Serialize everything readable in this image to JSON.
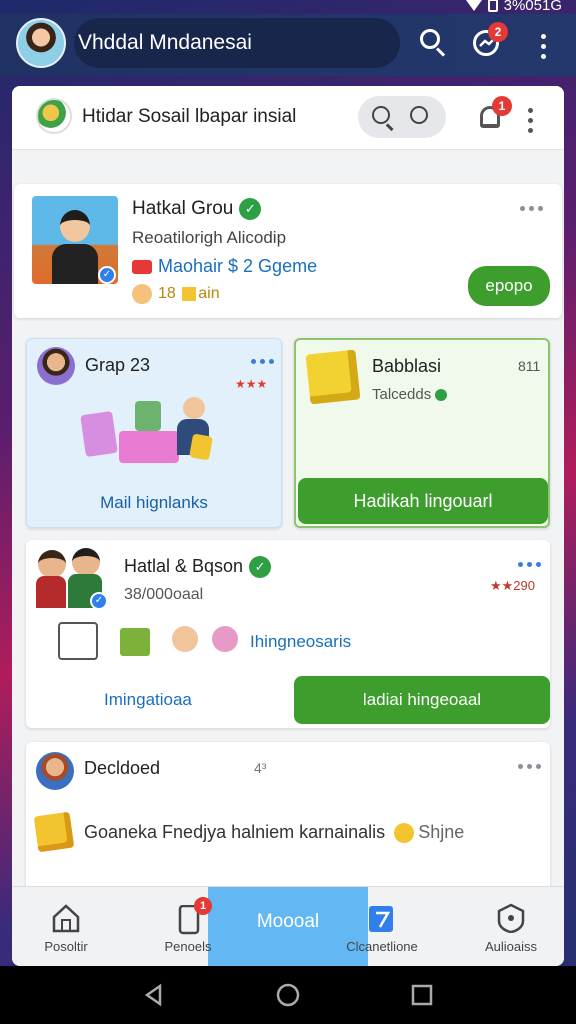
{
  "status_bar": {
    "text": "3%051G"
  },
  "header": {
    "title": "Vhddal Mndanesai",
    "notification_count": "2"
  },
  "sub_header": {
    "title": "Htidar Sosail lbapar insial",
    "bell_count": "1"
  },
  "card1": {
    "title": "Hatkal Grou",
    "subtitle": "Reoatilorigh Alicodip",
    "link_text": "Maohair $ 2 Ggeme",
    "meta": "18",
    "meta_tail": "ain",
    "button": "epopo"
  },
  "card2": {
    "title": "Grap 23",
    "stars": "★★★",
    "link": "Mail hignlanks"
  },
  "card3": {
    "title": "Babblasi",
    "count": "811",
    "status": "Talcedds",
    "button": "Hadikah lingouarl"
  },
  "card4": {
    "title": "Hatlal & Bqson",
    "subtitle": "38/000oaal",
    "rating": "★★290",
    "tags_text": "Ihingneosaris",
    "link": "Imingatioaa",
    "button": "ladiai hingeoaal"
  },
  "card5": {
    "title": "Decldoed",
    "time": "4³",
    "body": "Goaneka Fnedjya halniem karnainalis",
    "body_tail": "Shjne"
  },
  "bottom_nav": {
    "items": [
      {
        "label": "Posoltir",
        "icon": "home-icon"
      },
      {
        "label": "Penoels",
        "icon": "phone-icon",
        "badge": "1"
      },
      {
        "label": "Moooal",
        "icon": "active-tab"
      },
      {
        "label": "Clcanetlione",
        "icon": "tablet-icon"
      },
      {
        "label": "Aulioaiss",
        "icon": "shield-icon"
      }
    ]
  },
  "colors": {
    "header_bg": "#1f3263",
    "accent_green": "#3d9e2d",
    "accent_blue": "#1a6fbf",
    "active_tab": "#63b8f4",
    "badge_red": "#e53935"
  }
}
